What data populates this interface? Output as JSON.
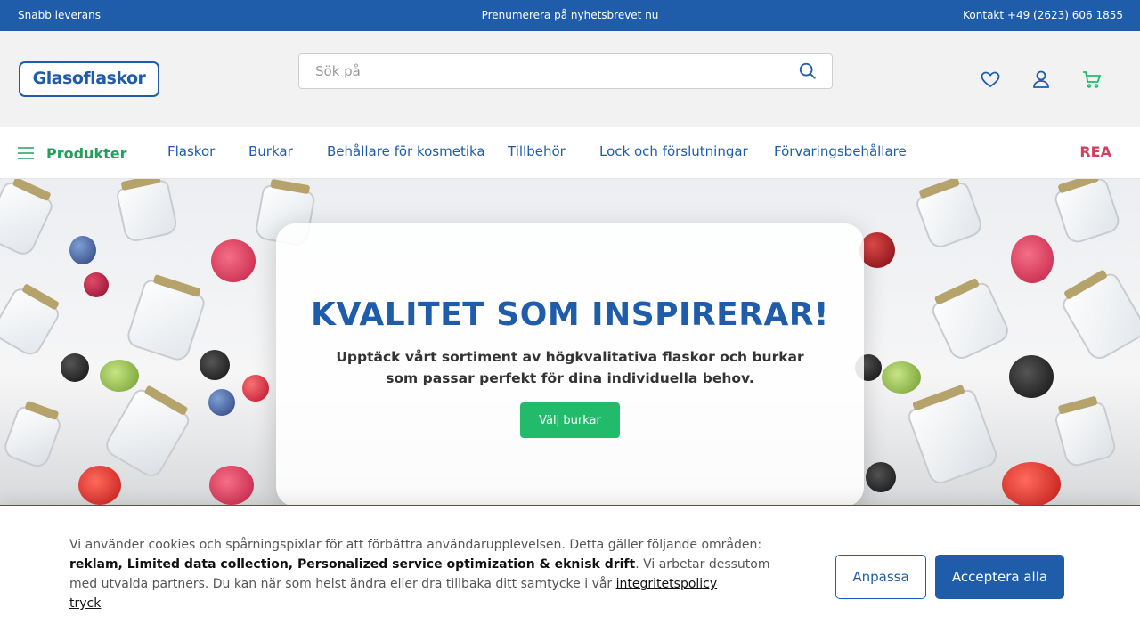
{
  "topbar": {
    "left": "Snabb leverans",
    "center": "Prenumerera på nyhetsbrevet nu",
    "right": "Kontakt +49 (2623) 606 1855"
  },
  "header": {
    "logo_text": "Glasoflaskor",
    "search_placeholder": "Sök på",
    "icons": [
      "heart-icon",
      "user-icon",
      "cart-icon"
    ]
  },
  "nav": {
    "menu_label": "Produkter",
    "links": [
      "Flaskor",
      "Burkar",
      "Behållare för kosmetika",
      "Tillbehör",
      "Lock och förslutningar",
      "Förvaringsbehållare"
    ],
    "sale": "REA"
  },
  "hero": {
    "title": "KVALITET SOM INSPIRERAR!",
    "text": "Upptäck vårt sortiment av högkvalitativa flaskor och burkar som passar perfekt för dina individuella behov.",
    "button": "Välj burkar"
  },
  "cookie": {
    "text_1": "Vi använder cookies och spårningspixlar för att förbättra användarupplevelsen. Detta gäller följande områden: ",
    "areas": "reklam, Limited data collection, Personalized service optimization & eknisk drift",
    "text_2": ". Vi arbetar dessutom med utvalda partners. Du kan när som helst ändra eller dra tillbaka ditt samtycke i vår ",
    "policy_link": "integritetspolicy",
    "imprint_link": "tryck",
    "adjust_button": "Anpassa",
    "accept_button": "Acceptera alla"
  },
  "colors": {
    "brand_blue": "#1f5dab",
    "accent_green": "#22bb6b",
    "sale_red": "#d23f5e"
  }
}
